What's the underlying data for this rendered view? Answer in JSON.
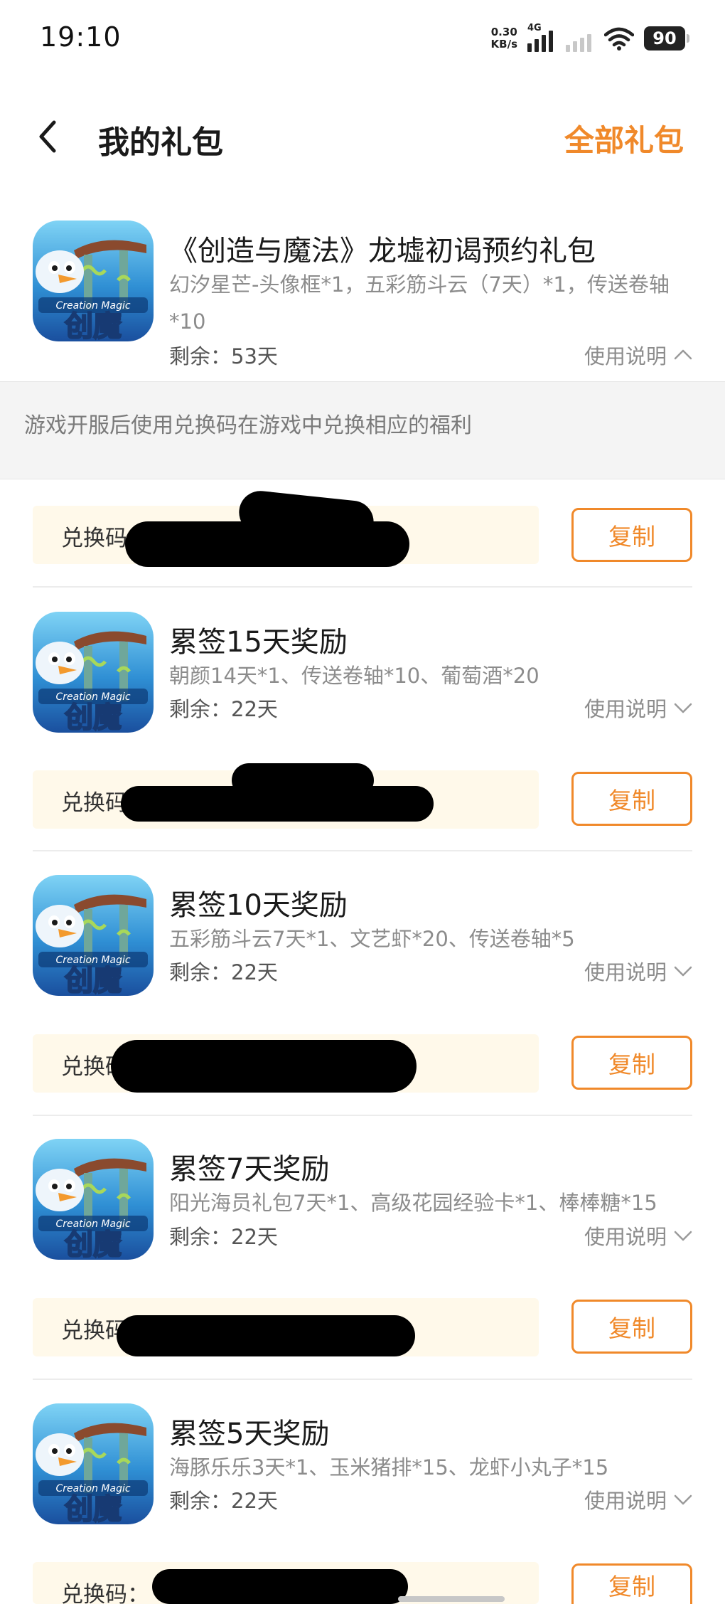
{
  "status_bar": {
    "time": "19:10",
    "net_speed_value": "0.30",
    "net_speed_unit": "KB/s",
    "network": "4G",
    "battery": "90"
  },
  "header": {
    "title": "我的礼包",
    "all_gifts_label": "全部礼包"
  },
  "colors": {
    "accent": "#f0892a",
    "code_bg": "#fff9ea",
    "explain_bg": "#f4f4f4"
  },
  "gifts": [
    {
      "title": "《创造与魔法》龙墟初谒预约礼包",
      "items": "幻汐星芒-头像框*1，五彩筋斗云（7天）*1，传送卷轴*10",
      "remaining": "剩余：53天",
      "usage_label": "使用说明",
      "expanded": true,
      "explanation": "游戏开服后使用兑换码在游戏中兑换相应的福利",
      "code_label": "兑换码",
      "copy_label": "复制"
    },
    {
      "title": "累签15天奖励",
      "items": "朝颜14天*1、传送卷轴*10、葡萄酒*20",
      "remaining": "剩余：22天",
      "usage_label": "使用说明",
      "code_label": "兑换码",
      "copy_label": "复制"
    },
    {
      "title": "累签10天奖励",
      "items": "五彩筋斗云7天*1、文艺虾*20、传送卷轴*5",
      "remaining": "剩余：22天",
      "usage_label": "使用说明",
      "code_label": "兑换码",
      "copy_label": "复制"
    },
    {
      "title": "累签7天奖励",
      "items": "阳光海员礼包7天*1、高级花园经验卡*1、棒棒糖*15",
      "remaining": "剩余：22天",
      "usage_label": "使用说明",
      "code_label": "兑换码",
      "copy_label": "复制"
    },
    {
      "title": "累签5天奖励",
      "items": "海豚乐乐3天*1、玉米猪排*15、龙虾小丸子*15",
      "remaining": "剩余：22天",
      "usage_label": "使用说明",
      "code_label": "兑换码：",
      "copy_label": "复制"
    }
  ],
  "icon_names": [
    "back-arrow-icon",
    "chevron-up-icon",
    "chevron-down-icon",
    "creation-magic-app-icon"
  ]
}
